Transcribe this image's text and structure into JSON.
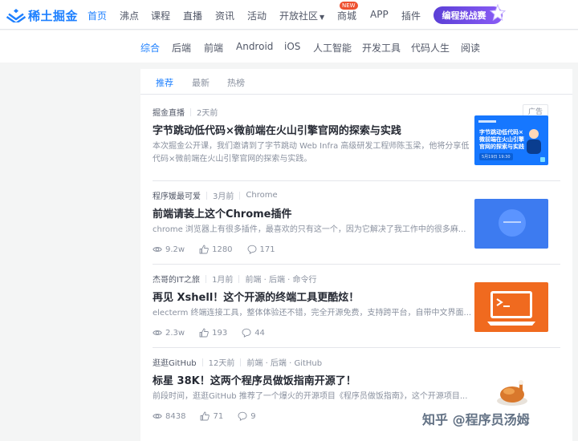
{
  "brand": {
    "name": "稀土掘金",
    "color": "#1e80ff"
  },
  "nav": {
    "items": [
      "首页",
      "沸点",
      "课程",
      "直播",
      "资讯",
      "活动",
      "开放社区",
      "商城",
      "APP",
      "插件"
    ],
    "active": "首页",
    "new_badge": "NEW",
    "promo_label": "编程挑战赛"
  },
  "categories": {
    "items": [
      "综合",
      "后端",
      "前端",
      "Android",
      "iOS",
      "人工智能",
      "开发工具",
      "代码人生",
      "阅读"
    ],
    "active": "综合"
  },
  "tabs": {
    "items": [
      "推荐",
      "最新",
      "热榜"
    ],
    "active": "推荐"
  },
  "articles": [
    {
      "author": "掘金直播",
      "time": "2天前",
      "tags": "",
      "ad": "广告",
      "title": "字节跳动低代码×微前端在火山引擎官网的探索与实践",
      "summary": "本次掘金公开课，我们邀请到了字节跳动 Web Infra 高级研发工程师陈玉梁，他将分享低代码×微前端在火山引擎官网的探索与实践。",
      "thumb_text": "字节跳动低代码×微前端在火山引擎官网的探索与实践",
      "thumb_sub": "5月19日 19:30"
    },
    {
      "author": "程序媛最可爱",
      "time": "3月前",
      "tags": "Chrome",
      "title": "前端请装上这个Chrome插件",
      "summary": "chrome 浏览器上有很多插件，最喜欢的只有这一个，因为它解决了我工作中的很多麻...",
      "views": "9.2w",
      "likes": "1280",
      "comments": "171"
    },
    {
      "author": "杰哥的IT之旅",
      "time": "1月前",
      "tags": "前端 · 后端 · 命令行",
      "title": "再见 Xshell！这个开源的终端工具更酷炫！",
      "summary": "electerm 终端连接工具，整体体验还不错，完全开源免费，支持跨平台，自带中文界面...",
      "views": "2.3w",
      "likes": "193",
      "comments": "44"
    },
    {
      "author": "逛逛GitHub",
      "time": "12天前",
      "tags": "前端 · 后端 · GitHub",
      "title": "标星 38K！这两个程序员做饭指南开源了！",
      "summary": "前段时间，逛逛GitHub 推荐了一个爆火的开源项目《程序员做饭指南》，这个开源项目...",
      "views": "8438",
      "likes": "71",
      "comments": "9"
    }
  ],
  "watermark": "知乎 @程序员汤姆",
  "icons": [
    "eye-icon",
    "thumb-up-icon",
    "comment-icon",
    "chevron-down-icon"
  ],
  "colors": {
    "accent": "#1e80ff",
    "text": "#252933",
    "muted": "#8a919f",
    "background": "#f4f5f5"
  }
}
